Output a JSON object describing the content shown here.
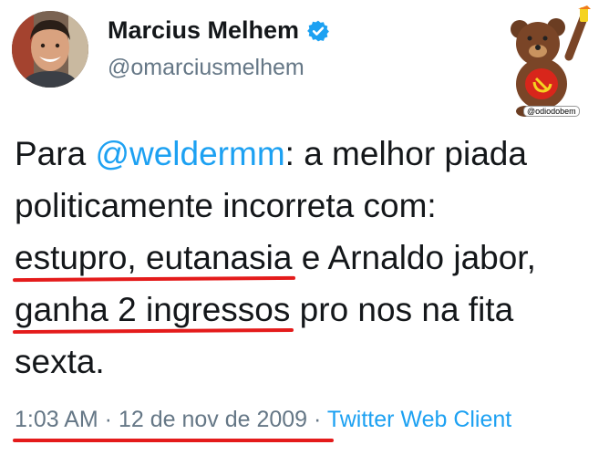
{
  "author": {
    "name": "Marcius Melhem",
    "handle": "@omarciusmelhem",
    "verified": true
  },
  "tweet": {
    "prefix": "Para ",
    "mention": "@weldermm",
    "line1_rest": ": a melhor piada",
    "line2": "politicamente incorreta com:",
    "underline1": "estupro, eutanasia",
    "line3_rest": " e Arnaldo jabor,",
    "underline2": "ganha 2 ingressos",
    "line4_rest": " pro nos na fita",
    "line5": "sexta."
  },
  "meta": {
    "time": "1:03 AM",
    "separator1": " · ",
    "date": "12 de nov de 2009",
    "separator2": " · ",
    "client": "Twitter Web Client"
  },
  "sticker": {
    "label": "@odiodobem"
  },
  "colors": {
    "link": "#1da1f2",
    "secondary_text": "#657786",
    "underline": "#e41b1b",
    "verified_badge": "#1da1f2"
  }
}
